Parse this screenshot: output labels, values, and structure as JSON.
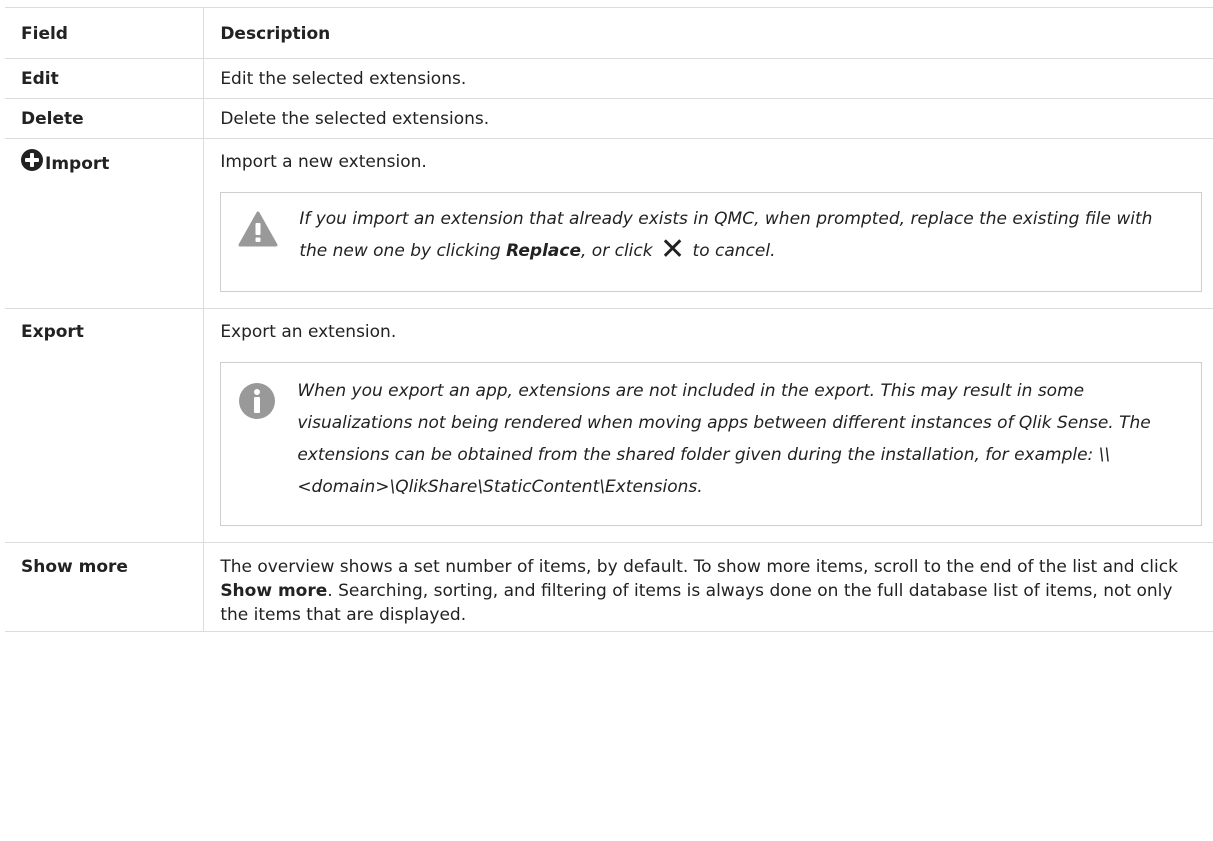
{
  "header": {
    "field": "Field",
    "description": "Description"
  },
  "rows": {
    "edit": {
      "field": "Edit",
      "description": "Edit the selected extensions."
    },
    "delete": {
      "field": "Delete",
      "description": "Delete the selected extensions."
    },
    "import": {
      "field": "Import",
      "icon": "plus-circle-icon",
      "description": "Import a new extension.",
      "note": {
        "icon": "warning-icon",
        "text_before": "If you import an extension that already exists in QMC, when prompted, replace the existing file with the new one by clicking ",
        "bold": "Replace",
        "text_middle": ", or click ",
        "x_icon": "close-icon",
        "text_after": " to cancel."
      }
    },
    "export": {
      "field": "Export",
      "description": "Export an extension.",
      "note": {
        "icon": "info-icon",
        "text": "When you export an app, extensions are not included in the export. This may result in some visualizations not being rendered when moving apps between different instances of Qlik Sense. The extensions can be obtained from the shared folder given during the installation, for example: \\\\<domain>\\QlikShare\\StaticContent\\Extensions."
      }
    },
    "show_more": {
      "field": "Show more",
      "text_before": "The overview shows a set number of items, by default. To show more items, scroll to the end of the list and click ",
      "bold": "Show more",
      "text_after": ". Searching, sorting, and filtering of items is always done on the full database list of items, not only the items that are displayed."
    }
  },
  "colors": {
    "border": "#dcdcdc",
    "icon_gray": "#999999",
    "text": "#222222"
  }
}
